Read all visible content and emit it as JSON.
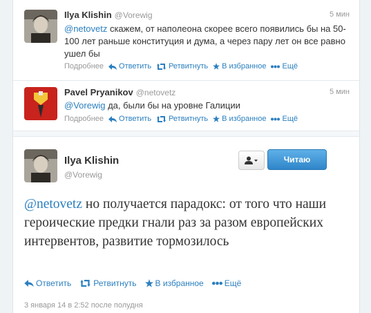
{
  "tweets": [
    {
      "name": "Ilya Klishin",
      "handle": "@Vorewig",
      "time": "5 мин",
      "mention": "@netovetz",
      "text": " скажем, от наполеона скорее всего появились бы на 50-100 лет раньше конституция и дума, а через пару лет он все равно ушел бы"
    },
    {
      "name": "Pavel Pryanikov",
      "handle": "@netovetz",
      "time": "5 мин",
      "mention": "@Vorewig",
      "text": " да, были бы на уровне Галиции"
    }
  ],
  "actions": {
    "details": "Подробнее",
    "reply": "Ответить",
    "retweet": "Ретвитнуть",
    "favorite": "В избранное",
    "more": "Ещё"
  },
  "main": {
    "name": "Ilya Klishin",
    "handle": "@Vorewig",
    "follow_label": "Читаю",
    "mention": "@netovetz",
    "text": " но получается парадокс: от того что наши героические предки гнали раз за разом европейских интервентов, развитие тормозилось",
    "date": "3 января 14 в 2:52 после полудня"
  },
  "colors": {
    "link": "#2a7fbf",
    "follow": "#2f86c9",
    "muted": "#999999"
  }
}
